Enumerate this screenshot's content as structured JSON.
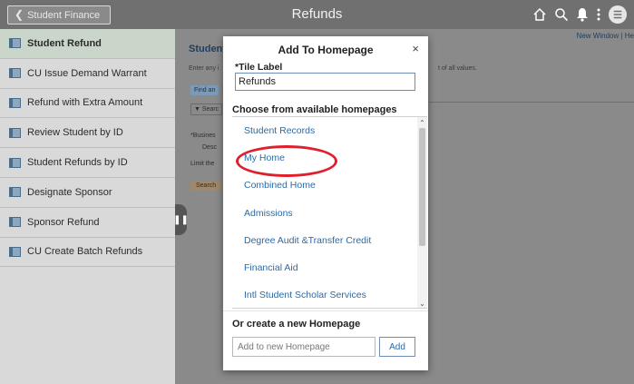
{
  "header": {
    "back_label": "Student Finance",
    "title": "Refunds",
    "icons": [
      "home-icon",
      "search-icon",
      "notification-icon",
      "more-actions-icon",
      "avatar-icon"
    ],
    "avatar_initial": "☰"
  },
  "sidebar": {
    "items": [
      {
        "label": "Student Refund",
        "active": true
      },
      {
        "label": "CU Issue Demand Warrant"
      },
      {
        "label": "Refund with Extra Amount"
      },
      {
        "label": "Review Student by ID"
      },
      {
        "label": "Student Refunds by ID"
      },
      {
        "label": "Designate Sponsor"
      },
      {
        "label": "Sponsor Refund"
      },
      {
        "label": "CU Create Batch Refunds"
      }
    ]
  },
  "main": {
    "title": "Student",
    "desc_left": "Enter any i",
    "desc_right": "t of all values.",
    "find_tab": "Find an",
    "search_criteria": "Searc",
    "crit_line1": "*Busines",
    "crit_line2": "Desc",
    "crit_line3": "Limit the",
    "search_button": "Search",
    "new_window": "New Window | He"
  },
  "modal": {
    "title": "Add To Homepage",
    "close": "×",
    "tile_label": "*Tile Label",
    "tile_value": "Refunds",
    "choose_label": "Choose from available homepages",
    "homepages": [
      "Student Records",
      "My Home",
      "Combined Home",
      "Admissions",
      "Degree Audit &Transfer Credit",
      "Financial Aid",
      "Intl Student Scholar Services"
    ],
    "highlighted": "My Home",
    "create_label": "Or create a new Homepage",
    "new_placeholder": "Add to new Homepage",
    "add_button": "Add"
  },
  "colors": {
    "header_bg": "#707070",
    "link_blue": "#2a6aa8",
    "highlight_red": "#e01f2d"
  }
}
